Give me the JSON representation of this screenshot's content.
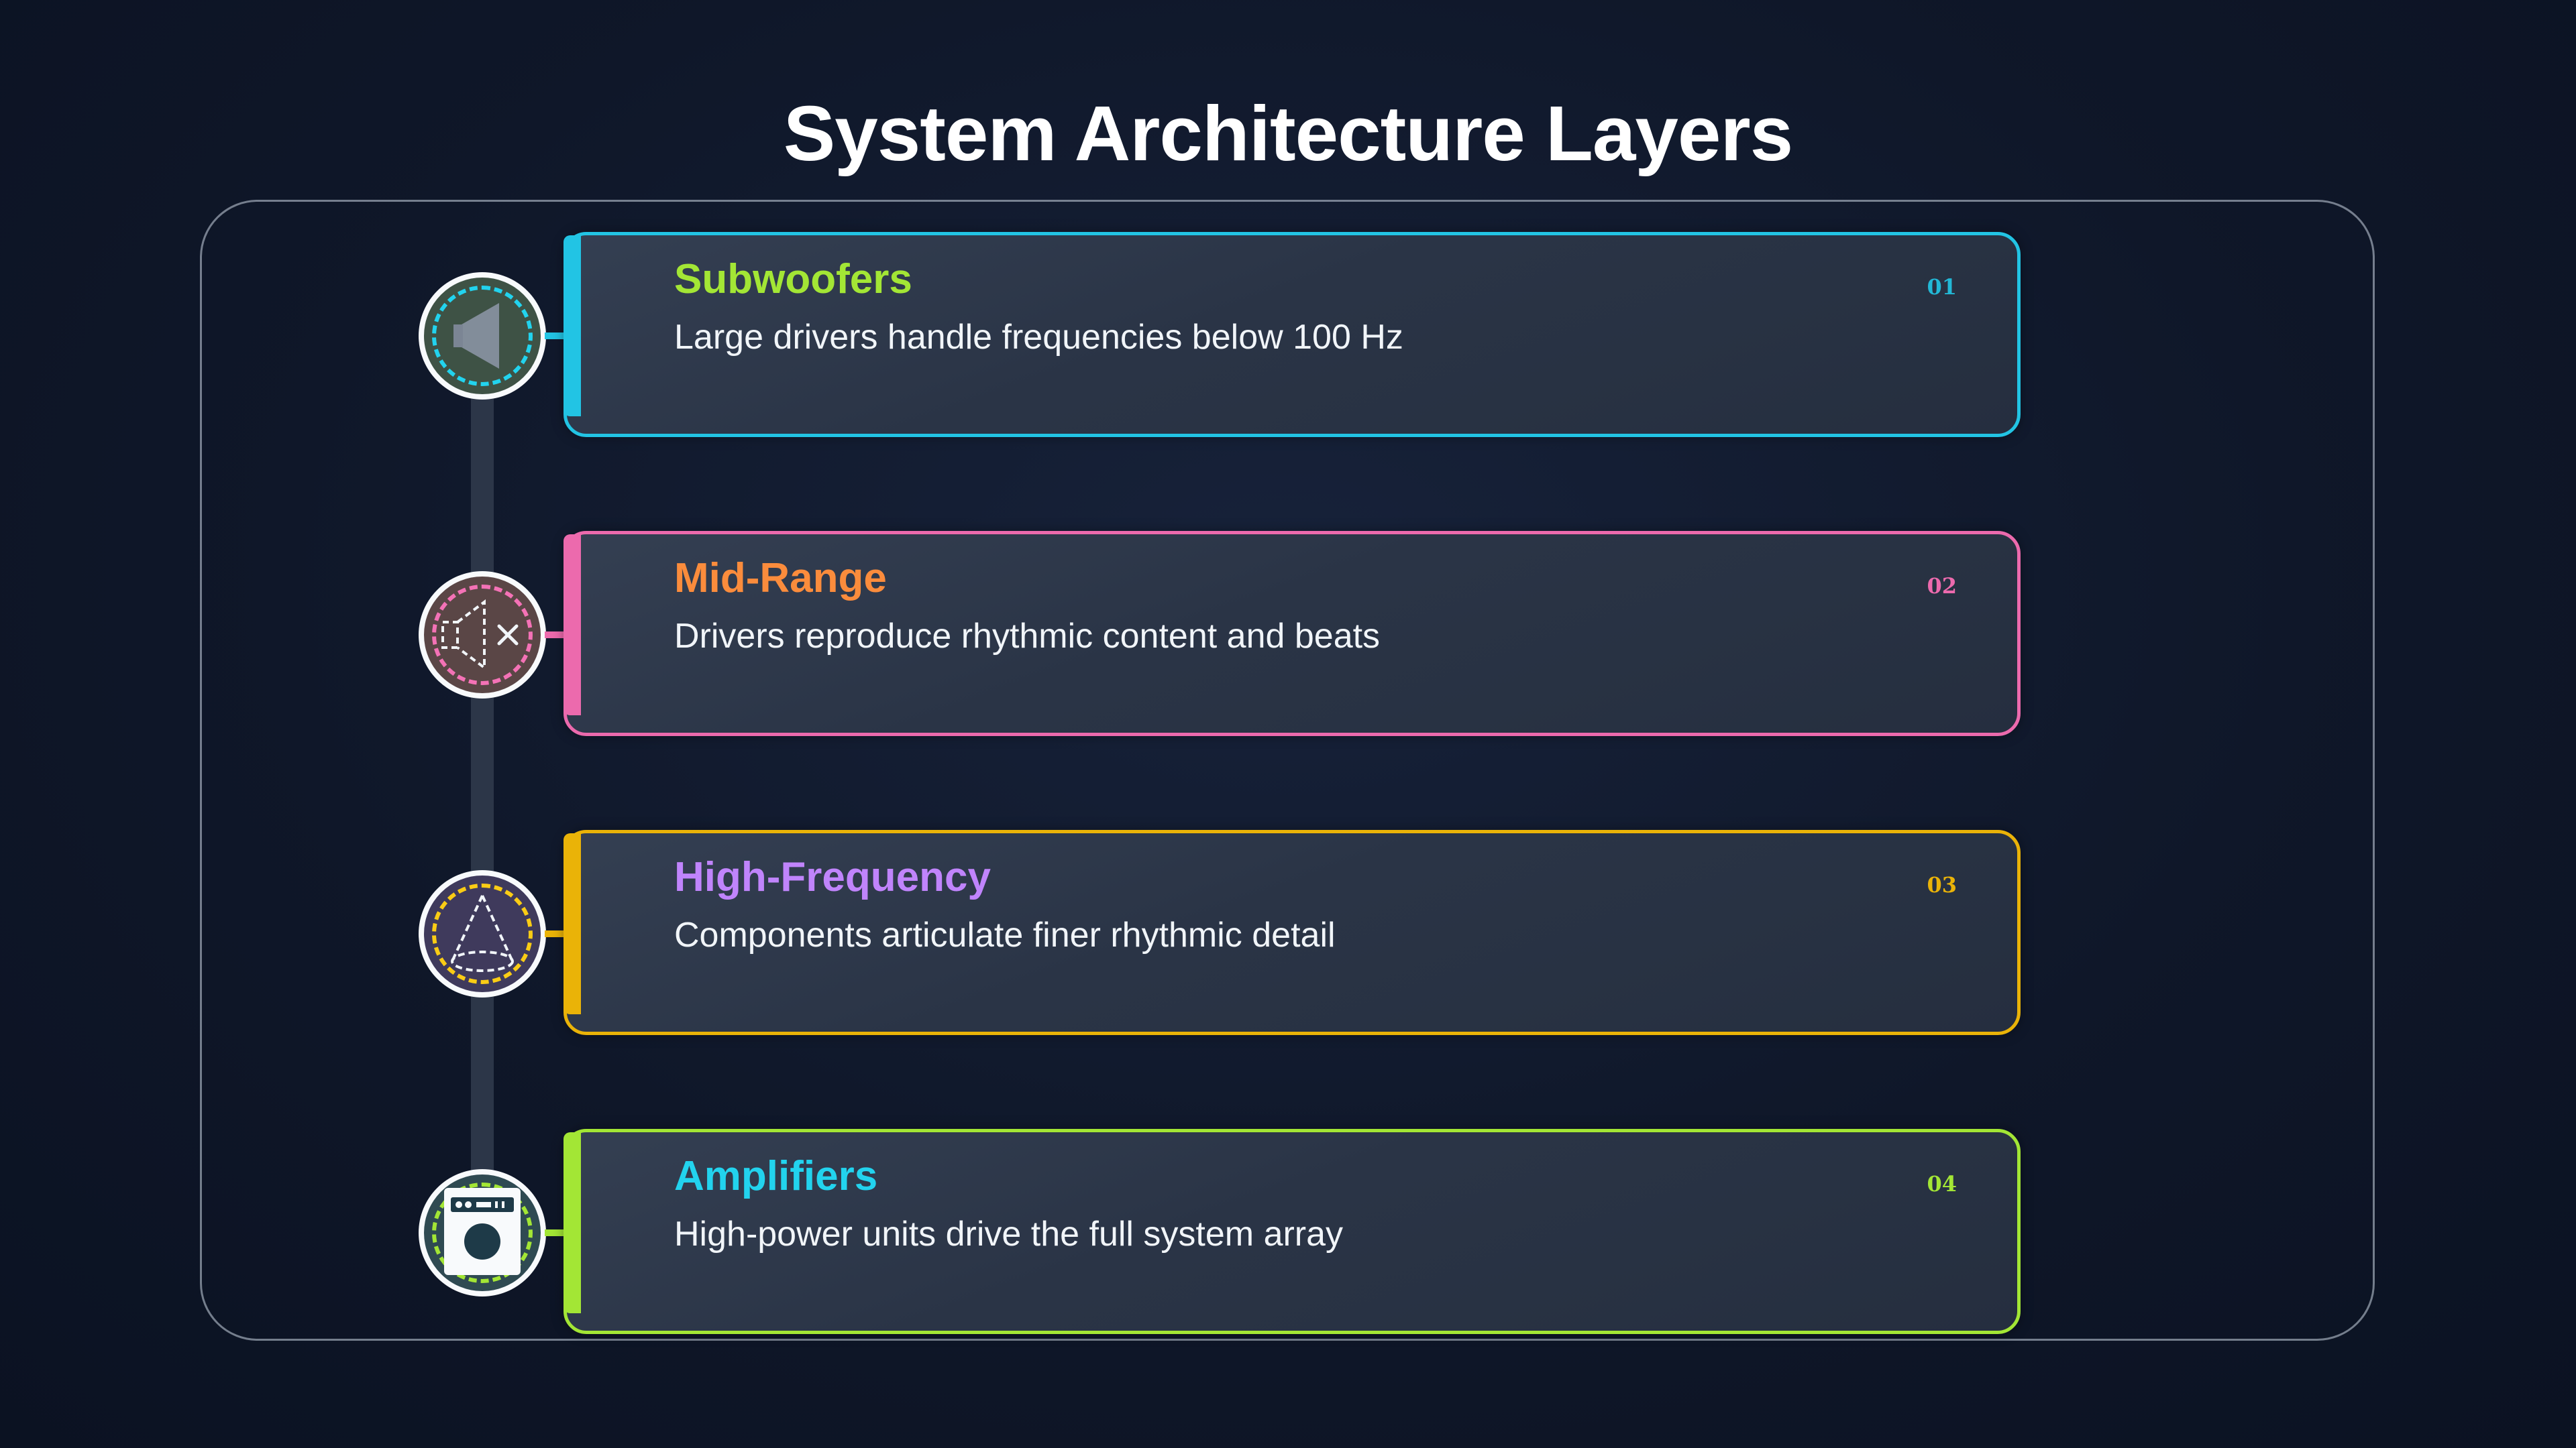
{
  "title": "System Architecture Layers",
  "layers": [
    {
      "number": "01",
      "title": "Subwoofers",
      "description": "Large drivers handle frequencies below 100 Hz",
      "icon": "subwoofer-speaker-icon",
      "border_color": "#22c4e4",
      "title_color": "#a3e635",
      "number_color": "#22b8d6",
      "ring_color": "#22d3ee",
      "node_fill": "#3e5245"
    },
    {
      "number": "02",
      "title": "Mid-Range",
      "description": "Drivers reproduce rhythmic content and beats",
      "icon": "speaker-mute-icon",
      "border_color": "#ec6aad",
      "title_color": "#fb8c3c",
      "number_color": "#ec6aad",
      "ring_color": "#f472b6",
      "node_fill": "#5a4646"
    },
    {
      "number": "03",
      "title": "High-Frequency",
      "description": "Components articulate finer rhythmic detail",
      "icon": "tweeter-cone-icon",
      "border_color": "#eab308",
      "title_color": "#c084fc",
      "number_color": "#eab308",
      "ring_color": "#facc15",
      "node_fill": "#3f3a5c"
    },
    {
      "number": "04",
      "title": "Amplifiers",
      "description": "High-power units drive the full system array",
      "icon": "amplifier-icon",
      "border_color": "#a3e635",
      "title_color": "#22d3ee",
      "number_color": "#a3e635",
      "ring_color": "#a3e635",
      "node_fill": "#2f4a52"
    }
  ]
}
